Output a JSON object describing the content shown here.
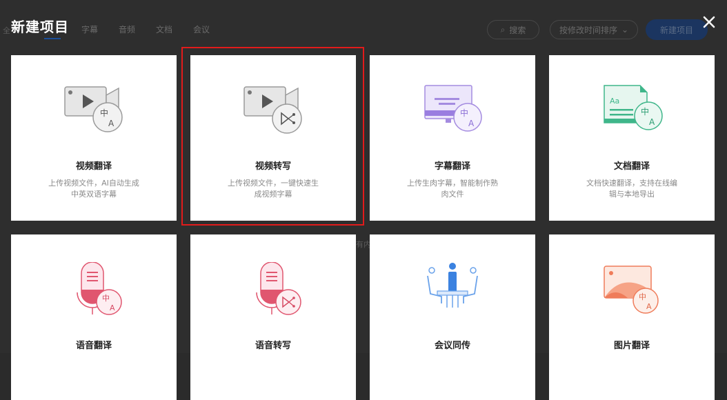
{
  "modal": {
    "title": "新建项目",
    "close_icon": "close-icon"
  },
  "background": {
    "tabs": [
      "字幕",
      "音频",
      "文档",
      "会议"
    ],
    "search_label": "搜索",
    "sort_label": "按修改时间排序",
    "new_project_label": "新建项目",
    "fragment_left": "全",
    "fragment_mid": "有内"
  },
  "cards": [
    {
      "title": "视频翻译",
      "desc": "上传视频文件，AI自动生成中英双语字幕",
      "icon": "video-translate-icon"
    },
    {
      "title": "视频转写",
      "desc": "上传视频文件，一键快速生成视频字幕",
      "icon": "video-transcribe-icon"
    },
    {
      "title": "字幕翻译",
      "desc": "上传生肉字幕，智能制作熟肉文件",
      "icon": "subtitle-translate-icon"
    },
    {
      "title": "文档翻译",
      "desc": "文档快速翻译，支持在线编辑与本地导出",
      "icon": "document-translate-icon"
    },
    {
      "title": "语音翻译",
      "desc": "",
      "icon": "audio-translate-icon"
    },
    {
      "title": "语音转写",
      "desc": "",
      "icon": "audio-transcribe-icon"
    },
    {
      "title": "会议同传",
      "desc": "",
      "icon": "meeting-interpretation-icon"
    },
    {
      "title": "图片翻译",
      "desc": "",
      "icon": "image-translate-icon"
    }
  ]
}
